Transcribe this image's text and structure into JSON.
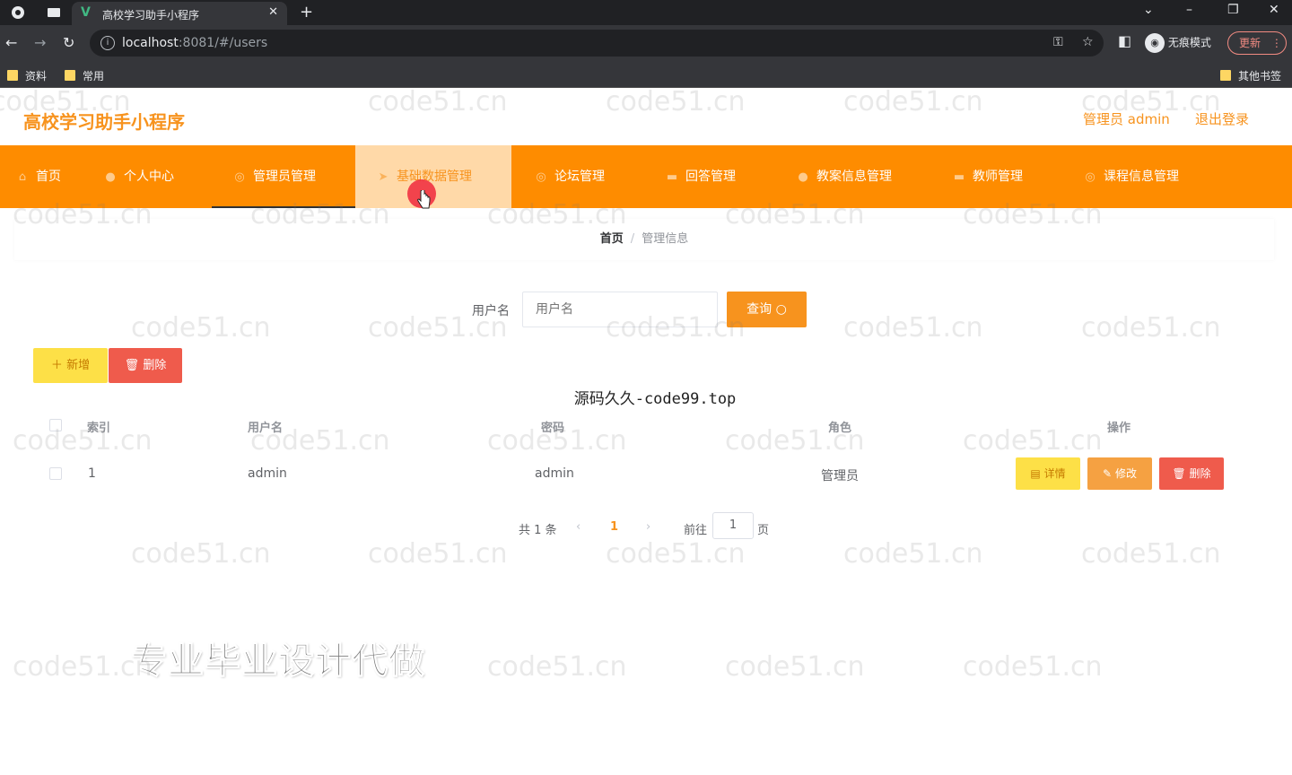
{
  "browser": {
    "tab_title": "高校学习助手小程序",
    "url_host": "localhost",
    "url_rest": ":8081/#/users",
    "incognito_label": "无痕模式",
    "update_label": "更新",
    "bookmarks": [
      "资料",
      "常用"
    ],
    "other_bookmarks": "其他书签"
  },
  "header": {
    "title": "高校学习助手小程序",
    "user": "管理员 admin",
    "logout": "退出登录"
  },
  "nav": {
    "items": [
      {
        "label": "首页",
        "icon": "home-icon"
      },
      {
        "label": "个人中心",
        "icon": "person-icon"
      },
      {
        "label": "管理员管理",
        "icon": "circle-icon"
      },
      {
        "label": "基础数据管理",
        "icon": "send-icon"
      },
      {
        "label": "论坛管理",
        "icon": "circle-icon"
      },
      {
        "label": "回答管理",
        "icon": "chat-icon"
      },
      {
        "label": "教案信息管理",
        "icon": "person-icon"
      },
      {
        "label": "教师管理",
        "icon": "chat-icon"
      },
      {
        "label": "课程信息管理",
        "icon": "circle-icon"
      }
    ],
    "active_index": 2,
    "hover_index": 3
  },
  "breadcrumb": {
    "home": "首页",
    "separator": "/",
    "current": "管理信息"
  },
  "search": {
    "label": "用户名",
    "placeholder": "用户名",
    "button": "查询"
  },
  "actions": {
    "add": "新增",
    "delete": "删除"
  },
  "overlay_caption": "源码久久-code99.top",
  "table": {
    "columns": [
      "索引",
      "用户名",
      "密码",
      "角色",
      "操作"
    ],
    "rows": [
      {
        "index": "1",
        "username": "admin",
        "password": "admin",
        "role": "管理员"
      }
    ],
    "row_actions": {
      "detail": "详情",
      "edit": "修改",
      "delete": "删除"
    }
  },
  "pagination": {
    "total": "共 1 条",
    "current_page": "1",
    "goto_label": "前往",
    "goto_value": "1",
    "page_suffix": "页"
  },
  "promo_text": "专业毕业设计代做",
  "watermark_text": "code51.cn",
  "colors": {
    "accent": "#f7931e",
    "nav_bg": "#fe8c00",
    "danger": "#ef5b4c",
    "warning": "#fde047"
  }
}
